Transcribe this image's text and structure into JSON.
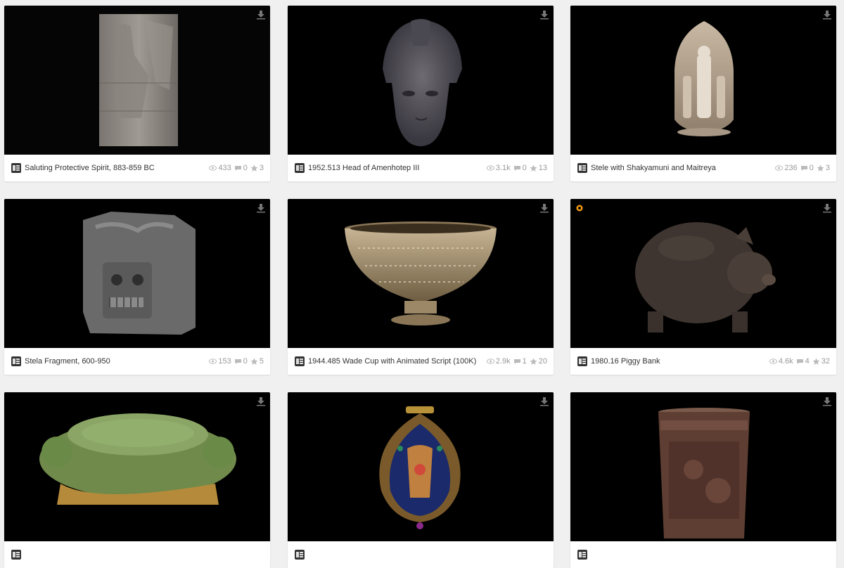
{
  "icons": {
    "download": "download-icon",
    "views": "eye-icon",
    "comments": "speech-bubble-icon",
    "likes": "star-icon",
    "staff_pick": "staff-pick-badge-icon"
  },
  "colors": {
    "card_bg": "#ffffff",
    "page_bg": "#f0f0f0",
    "thumb_bg": "#000000",
    "stats_text": "#999999",
    "staff_pick": "#f39c12"
  },
  "models": [
    {
      "title": "Saluting Protective Spirit, 883-859 BC",
      "views": "433",
      "comments": "0",
      "likes": "3",
      "staff_pick": false
    },
    {
      "title": "1952.513 Head of Amenhotep III",
      "views": "3.1k",
      "comments": "0",
      "likes": "13",
      "staff_pick": false
    },
    {
      "title": "Stele with Shakyamuni and Maitreya",
      "views": "236",
      "comments": "0",
      "likes": "3",
      "staff_pick": false
    },
    {
      "title": "Stela Fragment, 600-950",
      "views": "153",
      "comments": "0",
      "likes": "5",
      "staff_pick": false
    },
    {
      "title": "1944.485 Wade Cup with Animated Script (100K)",
      "views": "2.9k",
      "comments": "1",
      "likes": "20",
      "staff_pick": false
    },
    {
      "title": "1980.16 Piggy Bank",
      "views": "4.6k",
      "comments": "4",
      "likes": "32",
      "staff_pick": true
    },
    {
      "title": "",
      "views": "",
      "comments": "",
      "likes": "",
      "staff_pick": false
    },
    {
      "title": "",
      "views": "",
      "comments": "",
      "likes": "",
      "staff_pick": false
    },
    {
      "title": "",
      "views": "",
      "comments": "",
      "likes": "",
      "staff_pick": false
    }
  ]
}
